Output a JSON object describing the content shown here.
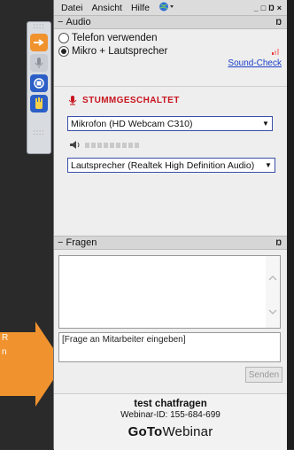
{
  "menu": {
    "items": [
      "Datei",
      "Ansicht",
      "Hilfe"
    ]
  },
  "window_buttons": [
    "_",
    "□",
    "Ŋ",
    "×"
  ],
  "audio": {
    "title": "Audio",
    "option_phone": "Telefon verwenden",
    "option_mic": "Mikro + Lautsprecher",
    "selected": "Mikro + Lautsprecher",
    "sound_check": "Sound-Check",
    "muted_label": "STUMMGESCHALTET",
    "mic_device": "Mikrofon (HD Webcam C310)",
    "speaker_device": "Lautsprecher (Realtek High Definition Audio)"
  },
  "questions": {
    "title": "Fragen",
    "input_placeholder": "[Frage an Mitarbeiter eingeben]",
    "send_label": "Senden"
  },
  "session": {
    "title": "test chatfragen",
    "webinar_id": "Webinar-ID: 155-684-699"
  },
  "brand": {
    "go": "Go",
    "to": "To",
    "webinar": "Webinar"
  },
  "arrow_text": [
    "R",
    "n"
  ],
  "colors": {
    "accent_orange": "#f0932e",
    "muted_red": "#c8141e",
    "link_blue": "#1a3fc8"
  }
}
